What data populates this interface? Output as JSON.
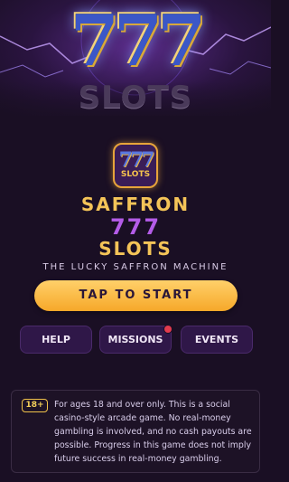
{
  "hero": {
    "logo_number": "777",
    "logo_word": "SLOTS"
  },
  "app_icon": {
    "number": "777",
    "word": "SLOTS"
  },
  "title": {
    "line1": "SAFFRON",
    "line2": "777",
    "line3": "SLOTS"
  },
  "tagline": "THE LUCKY SAFFRON MACHINE",
  "start_button": "TAP TO START",
  "nav": {
    "help": "HELP",
    "missions": "MISSIONS",
    "events": "EVENTS",
    "missions_has_notification": true
  },
  "disclaimer": {
    "age_badge": "18+",
    "text": "For ages 18 and over only. This is a social casino-style arcade game. No real-money gambling is involved, and no cash payouts are possible. Progress in this game does not imply future success in real-money gambling."
  },
  "colors": {
    "accent_gold": "#f4c458",
    "accent_purple": "#b45ce8",
    "background": "#1a0f24",
    "notification": "#e23b4e"
  }
}
